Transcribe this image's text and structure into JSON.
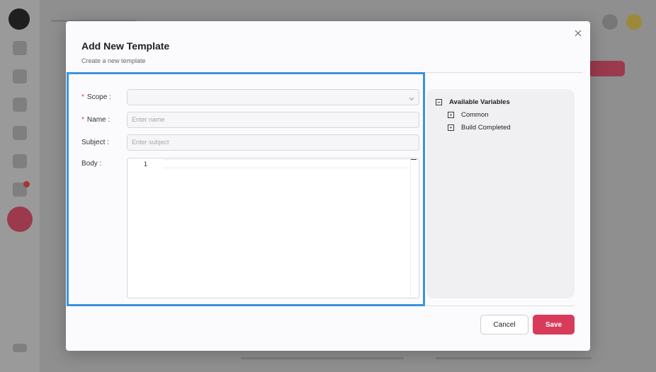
{
  "modal": {
    "title": "Add New Template",
    "subtitle": "Create a new template",
    "close_icon": "close-icon"
  },
  "form": {
    "scope": {
      "label": "Scope",
      "required_marker": "*",
      "value": "",
      "placeholder": ""
    },
    "name": {
      "label": "Name",
      "required_marker": "*",
      "value": "",
      "placeholder": "Enter name"
    },
    "subject": {
      "label": "Subject",
      "value": "",
      "placeholder": "Enter subject"
    },
    "body": {
      "label": "Body",
      "line_numbers": [
        "1"
      ]
    }
  },
  "variables": {
    "title": "Available Variables",
    "items": [
      {
        "label": "Common",
        "expand_icon": "plus-square-icon"
      },
      {
        "label": "Build Completed",
        "expand_icon": "plus-square-icon"
      }
    ]
  },
  "footer": {
    "cancel_label": "Cancel",
    "save_label": "Save"
  },
  "colors": {
    "accent": "#d83a5a",
    "highlight": "#3b93de"
  }
}
